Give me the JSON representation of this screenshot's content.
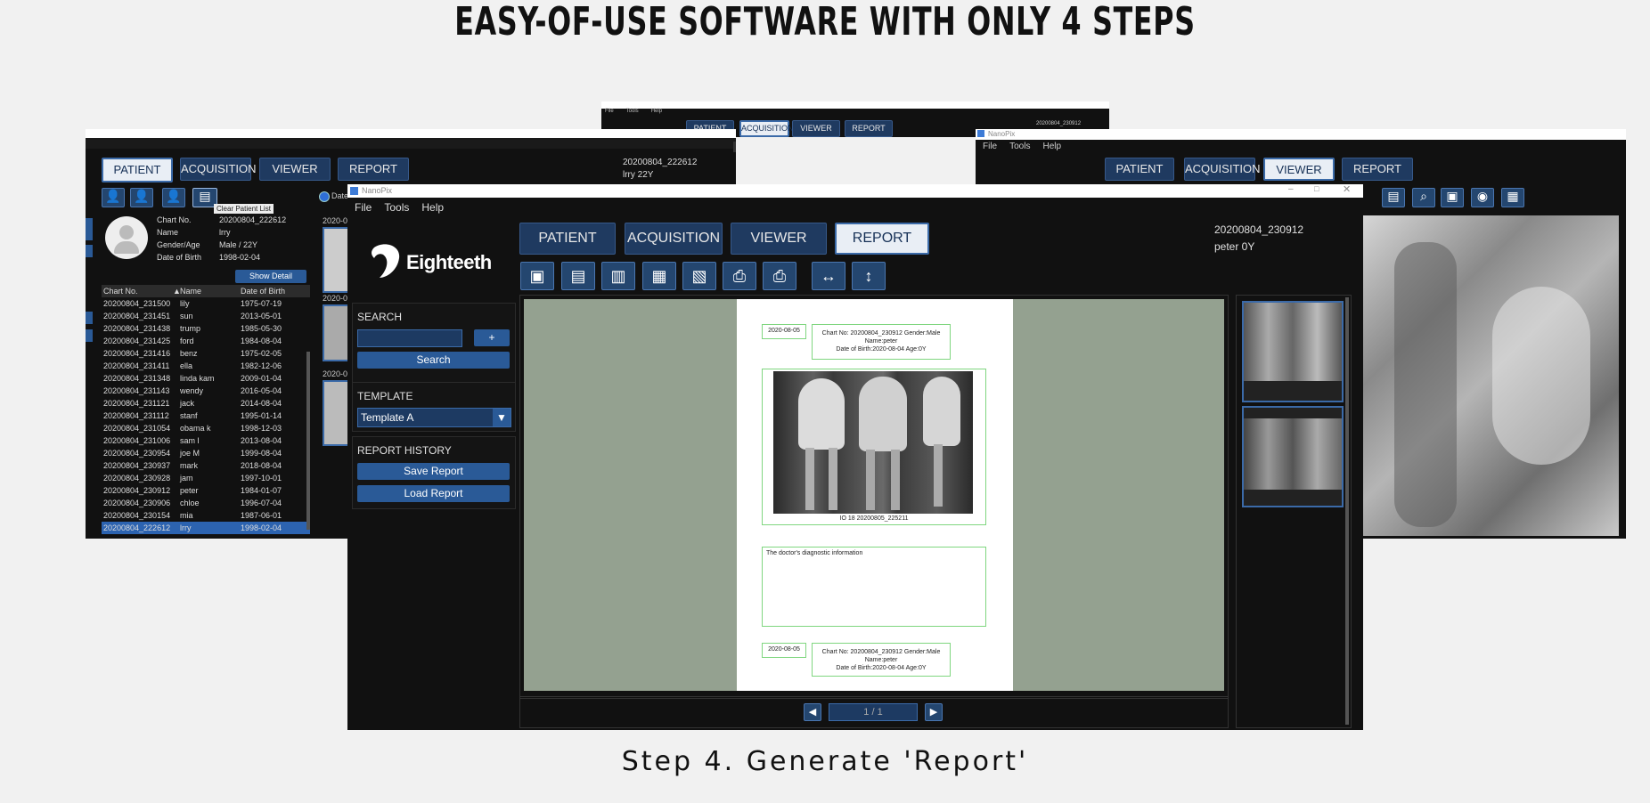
{
  "headline": "EASY-OF-USE SOFTWARE WITH ONLY 4 STEPS",
  "caption": "Step 4. Generate 'Report'",
  "colors": {
    "accent": "#1f3a60",
    "highlight": "#2a5a97",
    "report_bg": "#94a190",
    "box_green": "#7fd67f"
  },
  "top_window": {
    "title": "NanoPix",
    "menu": [
      "File",
      "Tools",
      "Help"
    ],
    "tabs": [
      "PATIENT",
      "ACQUISITION",
      "VIEWER",
      "REPORT"
    ],
    "patient": "20200804_230912"
  },
  "left_window": {
    "tabs": [
      "PATIENT",
      "ACQUISITION",
      "VIEWER",
      "REPORT"
    ],
    "patient_id": "20200804_222612",
    "patient_name": "lrry  22Y",
    "tooltip": "Clear Patient List",
    "date_radio": "Date",
    "info": [
      {
        "k": "Chart No.",
        "v": "20200804_222612"
      },
      {
        "k": "Name",
        "v": "lrry"
      },
      {
        "k": "Gender/Age",
        "v": "Male / 22Y"
      },
      {
        "k": "Date of Birth",
        "v": "1998-02-04"
      }
    ],
    "show_detail": "Show Detail",
    "columns": [
      "Chart No.",
      "Name",
      "Date of Birth"
    ],
    "rows": [
      [
        "20200804_231500",
        "lily",
        "1975-07-19"
      ],
      [
        "20200804_231451",
        "sun",
        "2013-05-01"
      ],
      [
        "20200804_231438",
        "trump",
        "1985-05-30"
      ],
      [
        "20200804_231425",
        "ford",
        "1984-08-04"
      ],
      [
        "20200804_231416",
        "benz",
        "1975-02-05"
      ],
      [
        "20200804_231411",
        "ella",
        "1982-12-06"
      ],
      [
        "20200804_231348",
        "linda kam",
        "2009-01-04"
      ],
      [
        "20200804_231143",
        "wendy",
        "2016-05-04"
      ],
      [
        "20200804_231121",
        "jack",
        "2014-08-04"
      ],
      [
        "20200804_231112",
        "stanf",
        "1995-01-14"
      ],
      [
        "20200804_231054",
        "obama k",
        "1998-12-03"
      ],
      [
        "20200804_231006",
        "sam l",
        "2013-08-04"
      ],
      [
        "20200804_230954",
        "joe M",
        "1999-08-04"
      ],
      [
        "20200804_230937",
        "mark",
        "2018-08-04"
      ],
      [
        "20200804_230928",
        "jam",
        "1997-10-01"
      ],
      [
        "20200804_230912",
        "peter",
        "1984-01-07"
      ],
      [
        "20200804_230906",
        "chloe",
        "1996-07-04"
      ],
      [
        "20200804_230154",
        "mia",
        "1987-06-01"
      ],
      [
        "20200804_222612",
        "lrry",
        "1998-02-04"
      ]
    ],
    "thumb_labels": [
      "2020-0",
      "2020-0",
      "2020-0"
    ]
  },
  "right_window": {
    "title": "NanoPix",
    "menu": [
      "File",
      "Tools",
      "Help"
    ],
    "tabs": [
      "PATIENT",
      "ACQUISITION",
      "VIEWER",
      "REPORT"
    ]
  },
  "main_window": {
    "title": "NanoPix",
    "menu": [
      "File",
      "Tools",
      "Help"
    ],
    "tabs": [
      "PATIENT",
      "ACQUISITION",
      "VIEWER",
      "REPORT"
    ],
    "active_tab": "REPORT",
    "patient_id": "20200804_230912",
    "patient_name": "peter  0Y",
    "logo_text": "Eighteeth",
    "search_title": "SEARCH",
    "search_add": "+",
    "search_button": "Search",
    "template_title": "TEMPLATE",
    "template_value": "Template A",
    "history_title": "REPORT HISTORY",
    "save_report": "Save Report",
    "load_report": "Load Report",
    "report": {
      "date": "2020-08-05",
      "header_line1": "Chart No: 20200804_230912  Gender:Male",
      "header_line2": "Name:peter",
      "header_line3": "Date of Birth:2020-08-04  Age:0Y",
      "image_caption": "IO 18 20200805_225211",
      "diagnosis": "The doctor's diagnostic information",
      "date2": "2020-08-05",
      "footer_line1": "Chart No: 20200804_230912  Gender:Male",
      "footer_line2": "Name:peter",
      "footer_line3": "Date of Birth:2020-08-04  Age:0Y"
    },
    "page_indicator": "1 / 1"
  }
}
